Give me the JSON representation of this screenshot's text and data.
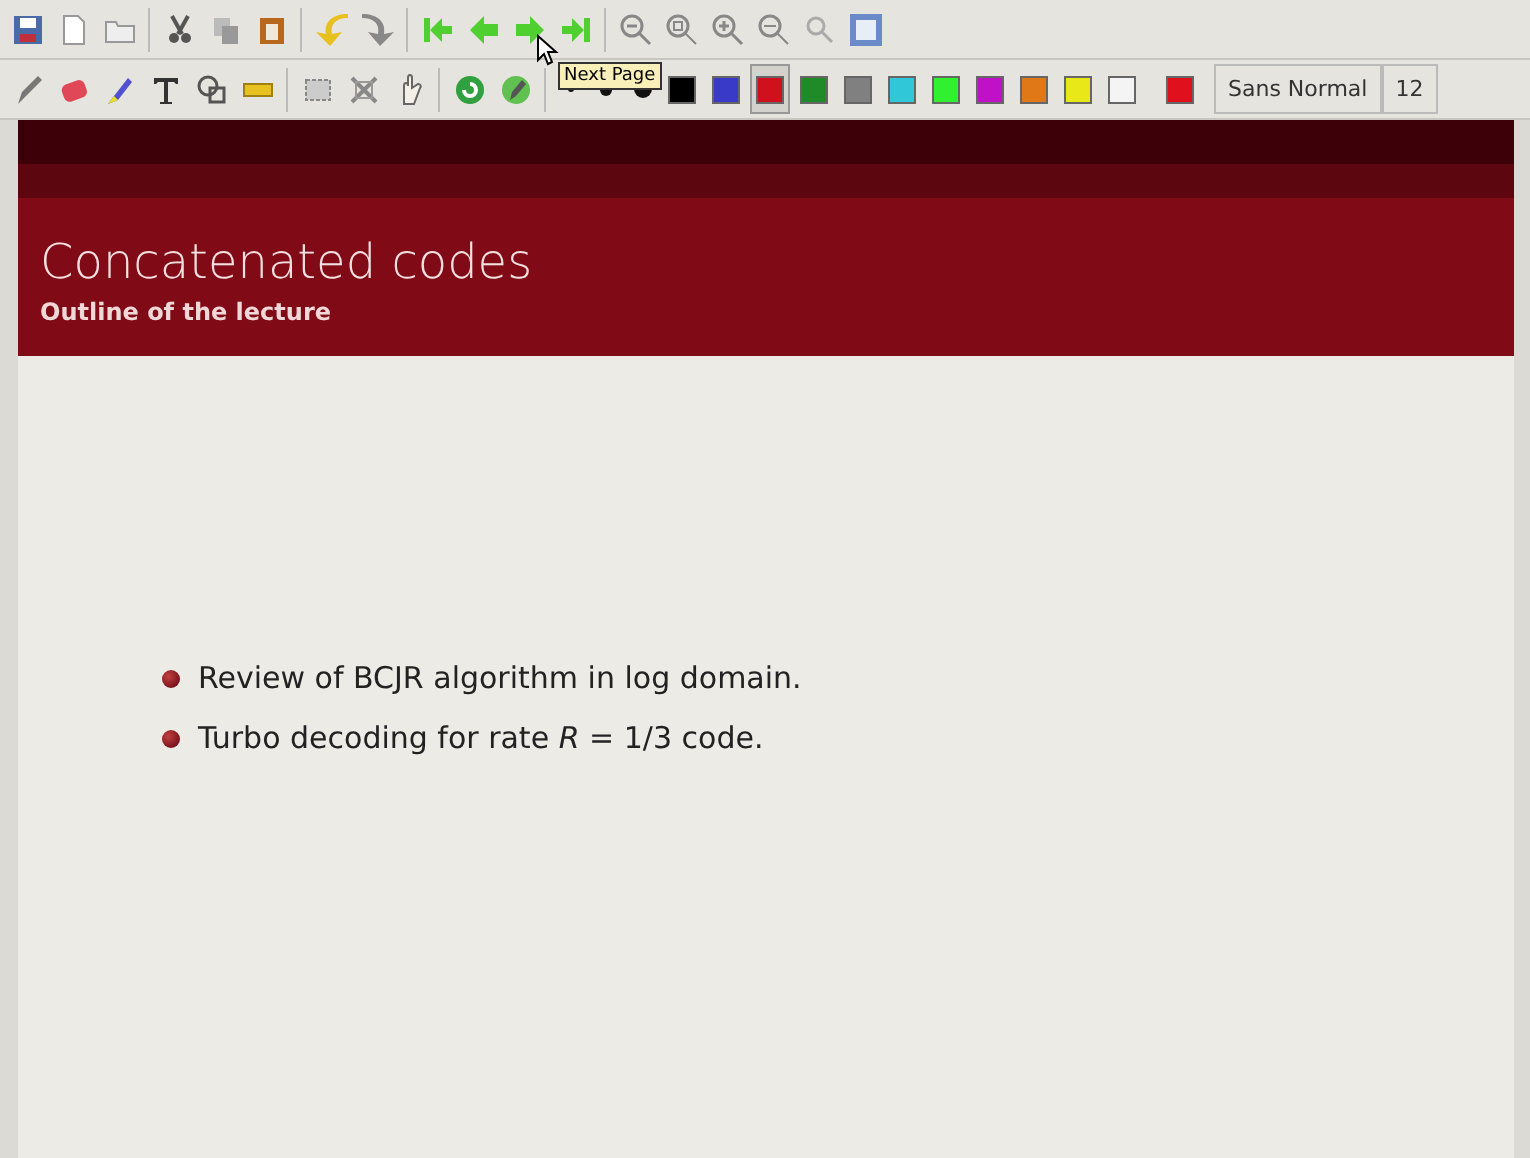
{
  "tooltip": "Next Page",
  "palette": [
    {
      "color": "#000000",
      "selected": false
    },
    {
      "color": "#3a3ac8",
      "selected": false
    },
    {
      "color": "#d0101c",
      "selected": true
    },
    {
      "color": "#1e8a28",
      "selected": false
    },
    {
      "color": "#808080",
      "selected": false
    },
    {
      "color": "#30c8d8",
      "selected": false
    },
    {
      "color": "#30f030",
      "selected": false
    },
    {
      "color": "#c010c8",
      "selected": false
    },
    {
      "color": "#e07818",
      "selected": false
    },
    {
      "color": "#e8e818",
      "selected": false
    },
    {
      "color": "#f4f4f4",
      "selected": false
    },
    {
      "kind": "current",
      "color": "#e0101c",
      "selected": false
    }
  ],
  "font_button": "Sans Normal",
  "font_size": "12",
  "slide": {
    "title": "Concatenated codes",
    "subtitle": "Outline of the lecture",
    "bullets": [
      "Review of BCJR algorithm in log domain.",
      "Turbo decoding for rate *R* = 1/3 code."
    ]
  }
}
